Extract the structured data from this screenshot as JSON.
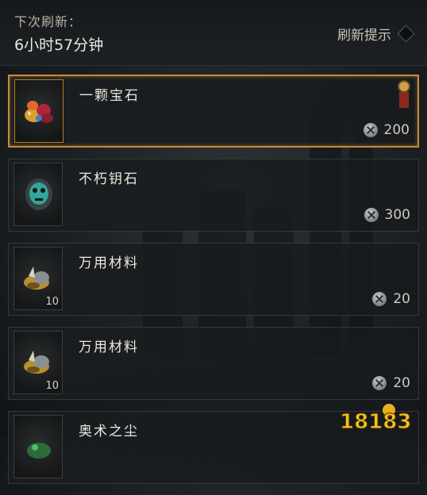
{
  "header": {
    "refresh_label": "下次刷新：",
    "refresh_time": "6小时57分钟",
    "tip_label": "刷新提示"
  },
  "items": [
    {
      "name": "一颗宝石",
      "price": "200",
      "quantity": "",
      "icon": "gem-cluster-icon",
      "selected": true
    },
    {
      "name": "不朽钥石",
      "price": "300",
      "quantity": "",
      "icon": "keystone-icon",
      "selected": false
    },
    {
      "name": "万用材料",
      "price": "20",
      "quantity": "10",
      "icon": "material-scrap-icon",
      "selected": false
    },
    {
      "name": "万用材料",
      "price": "20",
      "quantity": "10",
      "icon": "material-scrap-icon",
      "selected": false
    },
    {
      "name": "奥术之尘",
      "price": "",
      "quantity": "",
      "icon": "arcane-dust-icon",
      "selected": false
    }
  ],
  "watermark": {
    "text": "18183"
  },
  "colors": {
    "accent": "#c98a36",
    "text": "#ece8df",
    "panel": "#1a1d1f"
  }
}
